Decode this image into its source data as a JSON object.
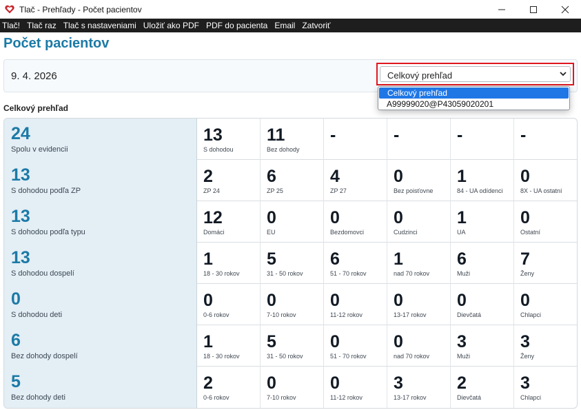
{
  "window": {
    "title": "Tlač - Prehľady - Počet pacientov",
    "controls": {
      "minimize": "—",
      "maximize": "☐",
      "close": "✕"
    }
  },
  "menu": [
    "Tlač!",
    "Tlač raz",
    "Tlač s nastaveniami",
    "Uložiť ako PDF",
    "PDF do pacienta",
    "Email",
    "Zatvoriť"
  ],
  "page": {
    "title": "Počet pacientov"
  },
  "filter": {
    "date": "9. 4. 2026",
    "selected": "Celkový prehľad",
    "options": [
      "Celkový prehľad",
      "A99999020@P43059020201"
    ]
  },
  "section_label": "Celkový prehľad",
  "rows": [
    {
      "value": "24",
      "label": "Spolu v evidencii",
      "cells": [
        {
          "value": "13",
          "label": "S dohodou"
        },
        {
          "value": "11",
          "label": "Bez dohody"
        },
        {
          "value": "-",
          "label": ""
        },
        {
          "value": "-",
          "label": ""
        },
        {
          "value": "-",
          "label": ""
        },
        {
          "value": "-",
          "label": ""
        }
      ]
    },
    {
      "value": "13",
      "label": "S dohodou podľa ZP",
      "cells": [
        {
          "value": "2",
          "label": "ZP 24"
        },
        {
          "value": "6",
          "label": "ZP 25"
        },
        {
          "value": "4",
          "label": "ZP 27"
        },
        {
          "value": "0",
          "label": "Bez poisťovne"
        },
        {
          "value": "1",
          "label": "84 - UA odídenci"
        },
        {
          "value": "0",
          "label": "8X - UA ostatní"
        }
      ]
    },
    {
      "value": "13",
      "label": "S dohodou podľa typu",
      "cells": [
        {
          "value": "12",
          "label": "Domáci"
        },
        {
          "value": "0",
          "label": "EU"
        },
        {
          "value": "0",
          "label": "Bezdomovci"
        },
        {
          "value": "0",
          "label": "Cudzinci"
        },
        {
          "value": "1",
          "label": "UA"
        },
        {
          "value": "0",
          "label": "Ostatní"
        }
      ]
    },
    {
      "value": "13",
      "label": "S dohodou dospelí",
      "cells": [
        {
          "value": "1",
          "label": "18 - 30 rokov"
        },
        {
          "value": "5",
          "label": "31 - 50 rokov"
        },
        {
          "value": "6",
          "label": "51 - 70 rokov"
        },
        {
          "value": "1",
          "label": "nad 70 rokov"
        },
        {
          "value": "6",
          "label": "Muži"
        },
        {
          "value": "7",
          "label": "Ženy"
        }
      ]
    },
    {
      "value": "0",
      "label": "S dohodou deti",
      "cells": [
        {
          "value": "0",
          "label": "0-6 rokov"
        },
        {
          "value": "0",
          "label": "7-10 rokov"
        },
        {
          "value": "0",
          "label": "11-12 rokov"
        },
        {
          "value": "0",
          "label": "13-17 rokov"
        },
        {
          "value": "0",
          "label": "Dievčatá"
        },
        {
          "value": "0",
          "label": "Chlapci"
        }
      ]
    },
    {
      "value": "6",
      "label": "Bez dohody dospelí",
      "cells": [
        {
          "value": "1",
          "label": "18 - 30 rokov"
        },
        {
          "value": "5",
          "label": "31 - 50 rokov"
        },
        {
          "value": "0",
          "label": "51 - 70 rokov"
        },
        {
          "value": "0",
          "label": "nad 70 rokov"
        },
        {
          "value": "3",
          "label": "Muži"
        },
        {
          "value": "3",
          "label": "Ženy"
        }
      ]
    },
    {
      "value": "5",
      "label": "Bez dohody deti",
      "cells": [
        {
          "value": "2",
          "label": "0-6 rokov"
        },
        {
          "value": "0",
          "label": "7-10 rokov"
        },
        {
          "value": "0",
          "label": "11-12 rokov"
        },
        {
          "value": "3",
          "label": "13-17 rokov"
        },
        {
          "value": "2",
          "label": "Dievčatá"
        },
        {
          "value": "3",
          "label": "Chlapci"
        }
      ]
    }
  ],
  "colors": {
    "accent": "#1b7aa6",
    "highlight": "#e0161f",
    "selection": "#1f77e6",
    "menubar": "#1e1e1e",
    "header_cell": "#e3eef5"
  }
}
